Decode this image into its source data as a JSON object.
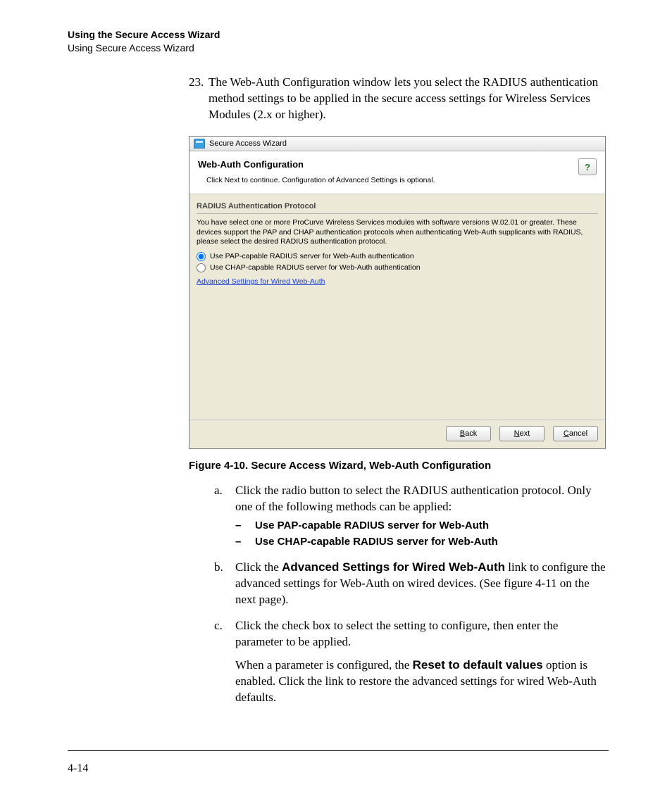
{
  "header": {
    "title": "Using the Secure Access Wizard",
    "subtitle": "Using Secure Access Wizard"
  },
  "step23": {
    "num": "23.",
    "text": "The Web-Auth Configuration window lets you select the RADIUS authentication method settings to be applied in the secure access settings for Wireless Services Modules (2.x or higher)."
  },
  "wizard": {
    "window_title": "Secure Access Wizard",
    "panel_title": "Web-Auth Configuration",
    "panel_subtitle": "Click Next to continue. Configuration of Advanced Settings is optional.",
    "help_label": "?",
    "fieldset_label": "RADIUS Authentication Protocol",
    "description": "You have select one or more ProCurve Wireless Services modules with software versions W.02.01 or greater. These devices support the PAP and CHAP authentication protocols when authenticating Web-Auth supplicants with RADIUS, please select the desired RADIUS authentication protocol.",
    "radio_pap": "Use PAP-capable RADIUS server for Web-Auth authentication",
    "radio_chap": "Use CHAP-capable RADIUS server for Web-Auth authentication",
    "advanced_link": "Advanced Settings for Wired Web-Auth",
    "buttons": {
      "back_u": "B",
      "back_rest": "ack",
      "next_u": "N",
      "next_rest": "ext",
      "cancel_u": "C",
      "cancel_rest": "ancel"
    }
  },
  "figure_caption": "Figure 4-10. Secure Access Wizard, Web-Auth Configuration",
  "step_a": {
    "letter": "a.",
    "text": "Click the radio button to select the RADIUS authentication protocol. Only one of the following methods can be applied:",
    "bullet1": "Use PAP-capable RADIUS server for Web-Auth",
    "bullet2": "Use CHAP-capable RADIUS server for Web-Auth"
  },
  "step_b": {
    "letter": "b.",
    "pre": "Click the ",
    "bold": "Advanced Settings for Wired Web-Auth",
    "post": " link to configure the advanced settings for Web-Auth on wired devices. (See figure 4-11 on the next page)."
  },
  "step_c": {
    "letter": "c.",
    "text1": "Click the check box to select the setting to configure, then enter the parameter to be applied.",
    "pre": "When a parameter is configured, the ",
    "bold": "Reset to default values",
    "post": " option is enabled. Click the link to restore the advanced settings for wired Web-Auth defaults."
  },
  "page_number": "4-14"
}
